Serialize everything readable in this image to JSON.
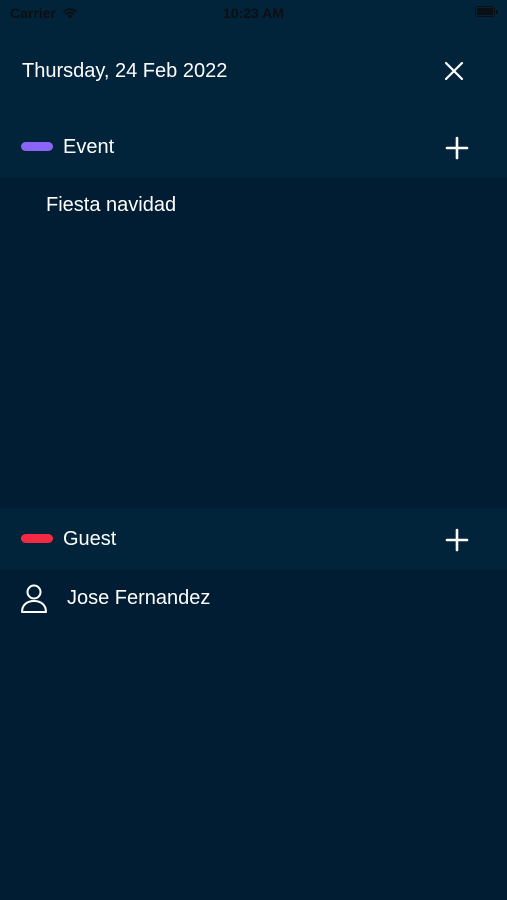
{
  "status_bar": {
    "carrier": "Carrier",
    "time": "10:23 AM"
  },
  "header": {
    "date": "Thursday, 24 Feb 2022",
    "close_icon": "close-icon"
  },
  "sections": {
    "event": {
      "label": "Event",
      "color": "#8a63f7",
      "add_icon": "plus-icon",
      "items": [
        "Fiesta navidad"
      ]
    },
    "guest": {
      "label": "Guest",
      "color": "#f42a44",
      "add_icon": "plus-icon",
      "items": [
        {
          "name": "Jose Fernandez",
          "icon": "person-icon"
        }
      ]
    }
  },
  "colors": {
    "background": "#011d33",
    "header_background": "#02243a",
    "text": "#ffffff"
  }
}
